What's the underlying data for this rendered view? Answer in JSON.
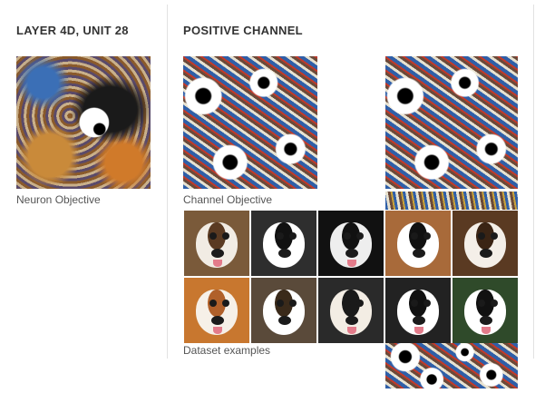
{
  "left_panel": {
    "heading": "LAYER 4D, UNIT 28",
    "caption": "Neuron Objective"
  },
  "right_panel": {
    "heading": "POSITIVE CHANNEL",
    "channel_caption": "Channel Objective",
    "dataset_caption": "Dataset examples"
  },
  "dataset_examples": [
    {
      "bg": "#7a5a3a",
      "face": "#f1ece4",
      "ear": "#5a3a22",
      "tongue": true
    },
    {
      "bg": "#2e2e2e",
      "face": "#ffffff",
      "ear": "#111111",
      "tongue": false
    },
    {
      "bg": "#111111",
      "face": "#eeeeee",
      "ear": "#111111",
      "tongue": true
    },
    {
      "bg": "#a86a3a",
      "face": "#ffffff",
      "ear": "#111111",
      "tongue": false
    },
    {
      "bg": "#5a3a22",
      "face": "#f4efe8",
      "ear": "#3a2414",
      "tongue": false
    },
    {
      "bg": "#c8772f",
      "face": "#f6f0e8",
      "ear": "#b0602a",
      "tongue": true
    },
    {
      "bg": "#5a4a3a",
      "face": "#ffffff",
      "ear": "#3a2a1a",
      "tongue": false
    },
    {
      "bg": "#2a2a2a",
      "face": "#f3ede4",
      "ear": "#1a1a1a",
      "tongue": true
    },
    {
      "bg": "#222222",
      "face": "#ffffff",
      "ear": "#111111",
      "tongue": true
    },
    {
      "bg": "#2f4a2a",
      "face": "#ffffff",
      "ear": "#111111",
      "tongue": true
    }
  ]
}
